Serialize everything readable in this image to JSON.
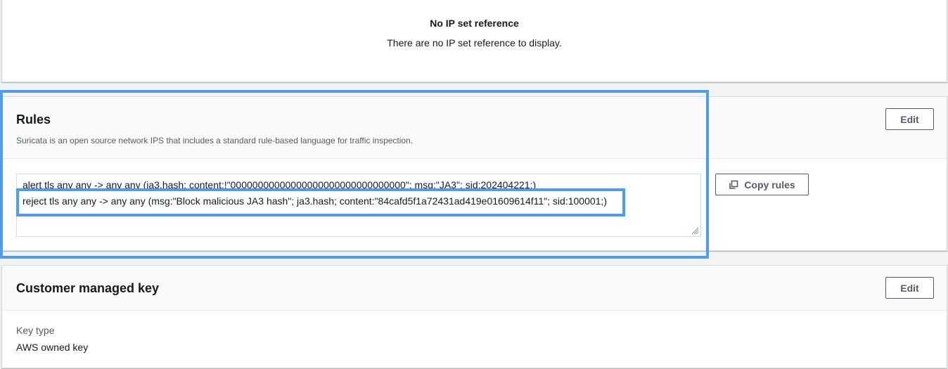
{
  "ip_set_reference": {
    "empty_title": "No IP set reference",
    "empty_description": "There are no IP set reference to display."
  },
  "rules": {
    "title": "Rules",
    "description": "Suricata is an open source network IPS that includes a standard rule-based language for traffic inspection.",
    "edit_label": "Edit",
    "copy_label": "Copy rules",
    "lines": [
      "alert tls any any -> any any (ja3.hash; content:!\"00000000000000000000000000000000\"; msg:\"JA3\"; sid:202404221;)",
      "reject tls any any -> any any (msg:\"Block malicious JA3 hash\"; ja3.hash; content:\"84cafd5f1a72431ad419e01609614f11\"; sid:100001;)"
    ]
  },
  "customer_managed_key": {
    "title": "Customer managed key",
    "edit_label": "Edit",
    "key_type_label": "Key type",
    "key_type_value": "AWS owned key"
  },
  "colors": {
    "highlight": "#4a9eed",
    "button_border": "#545b64",
    "panel_border": "#d5dbdb"
  },
  "icons": {
    "copy": "copy-icon",
    "resize": "resize-grip-icon"
  }
}
